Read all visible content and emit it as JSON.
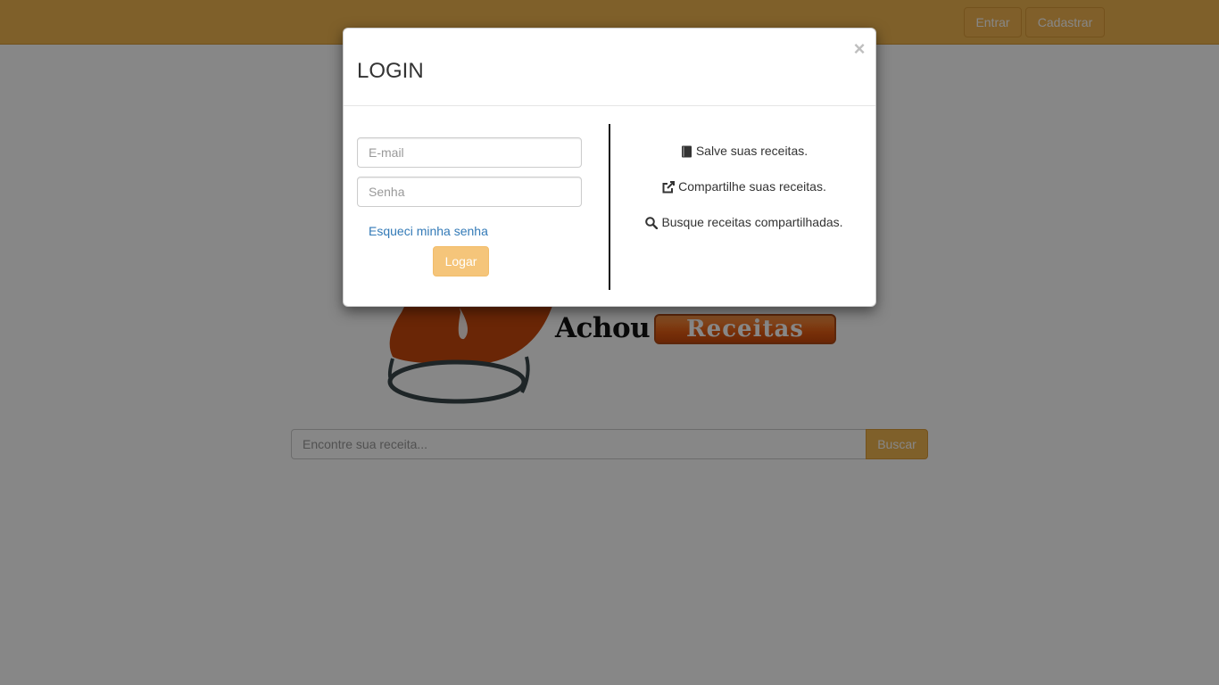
{
  "navbar": {
    "entrar_label": "Entrar",
    "cadastrar_label": "Cadastrar"
  },
  "logo": {
    "word_1": "Achou",
    "word_2": "Receitas"
  },
  "search": {
    "placeholder": "Encontre sua receita...",
    "button_label": "Buscar"
  },
  "modal": {
    "title": "LOGIN",
    "close_symbol": "×",
    "email_placeholder": "E-mail",
    "senha_placeholder": "Senha",
    "forgot_label": "Esqueci minha senha",
    "login_label": "Logar",
    "features": [
      {
        "icon": "book-icon",
        "text": "Salve suas receitas."
      },
      {
        "icon": "share-icon",
        "text": "Compartilhe suas receitas."
      },
      {
        "icon": "search-icon",
        "text": "Busque receitas compartilhadas."
      }
    ]
  },
  "colors": {
    "brand": "#f0b550",
    "link": "#337ab7",
    "logo_orange": "#e35c12"
  }
}
